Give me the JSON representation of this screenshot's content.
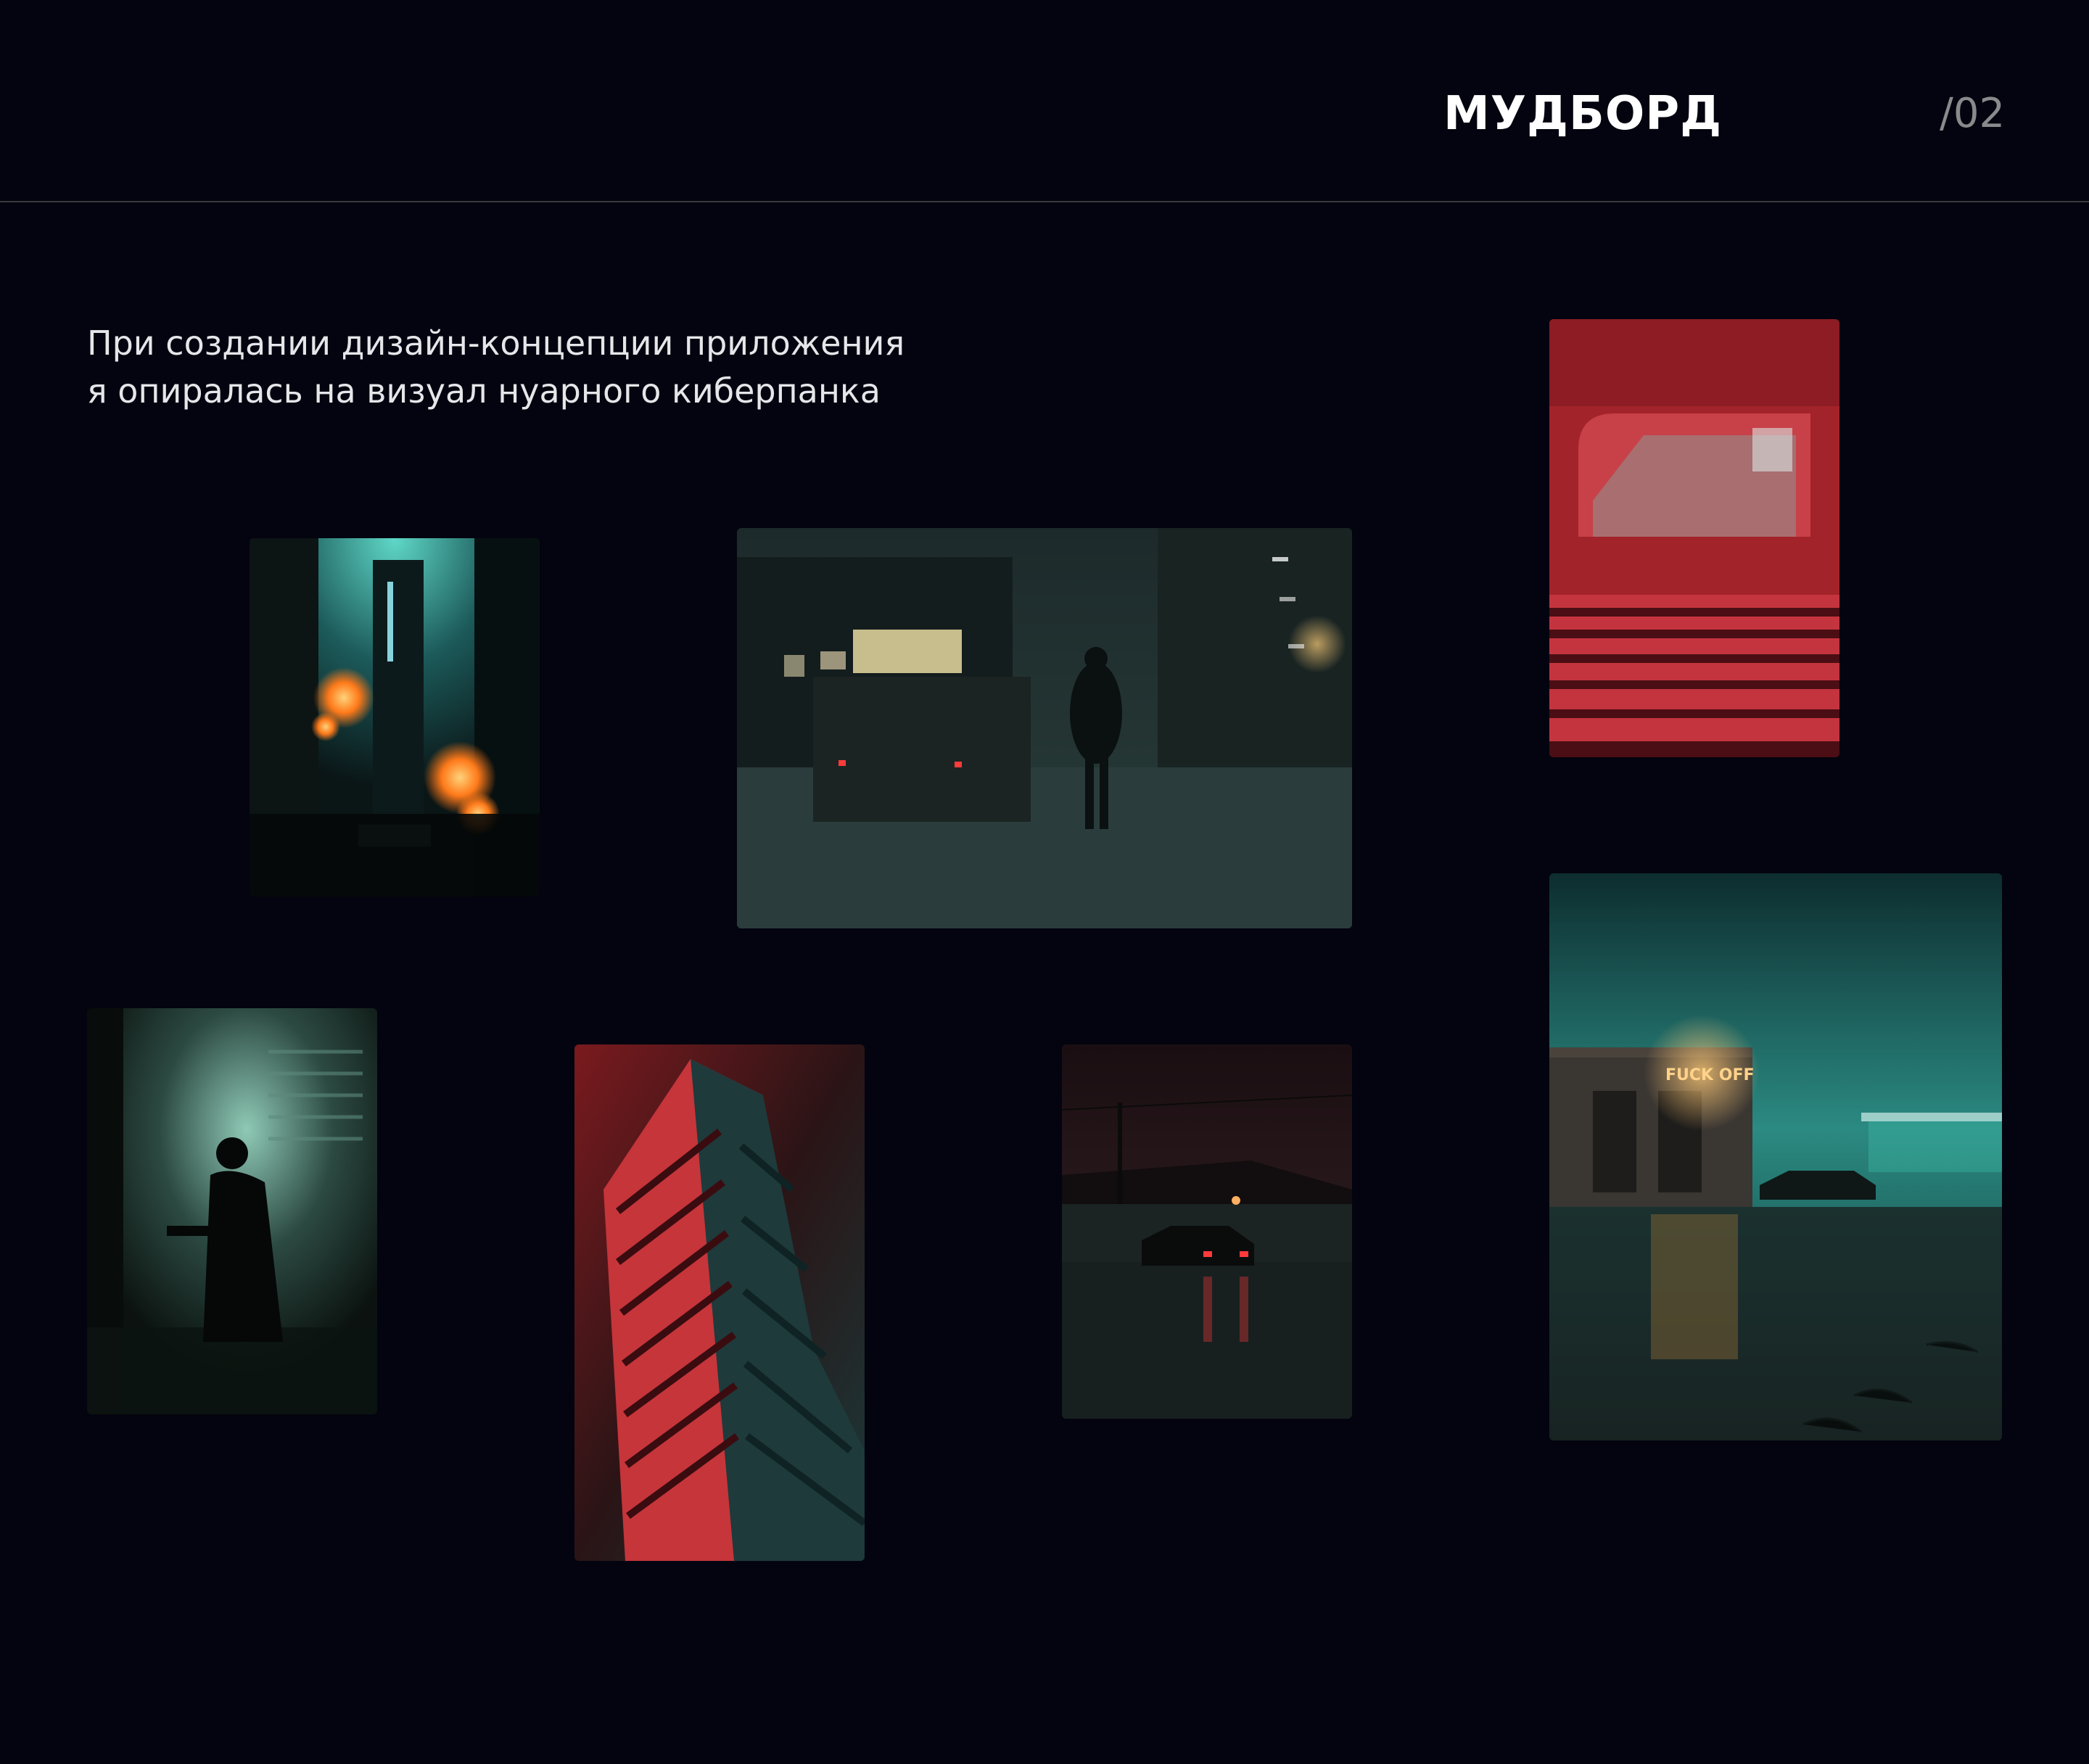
{
  "header": {
    "title": "МУДБОРД",
    "page_number": "/02"
  },
  "intro": {
    "line1": "При создании дизайн-концепции приложения",
    "line2": "я опиралась на визуал нуарного киберпанка"
  },
  "photos": {
    "sign_text": "FUCK OFF"
  },
  "colors": {
    "background": "#03040f",
    "teal": "#3fb8a8",
    "red": "#d8333a",
    "orange": "#ff8a2a"
  }
}
